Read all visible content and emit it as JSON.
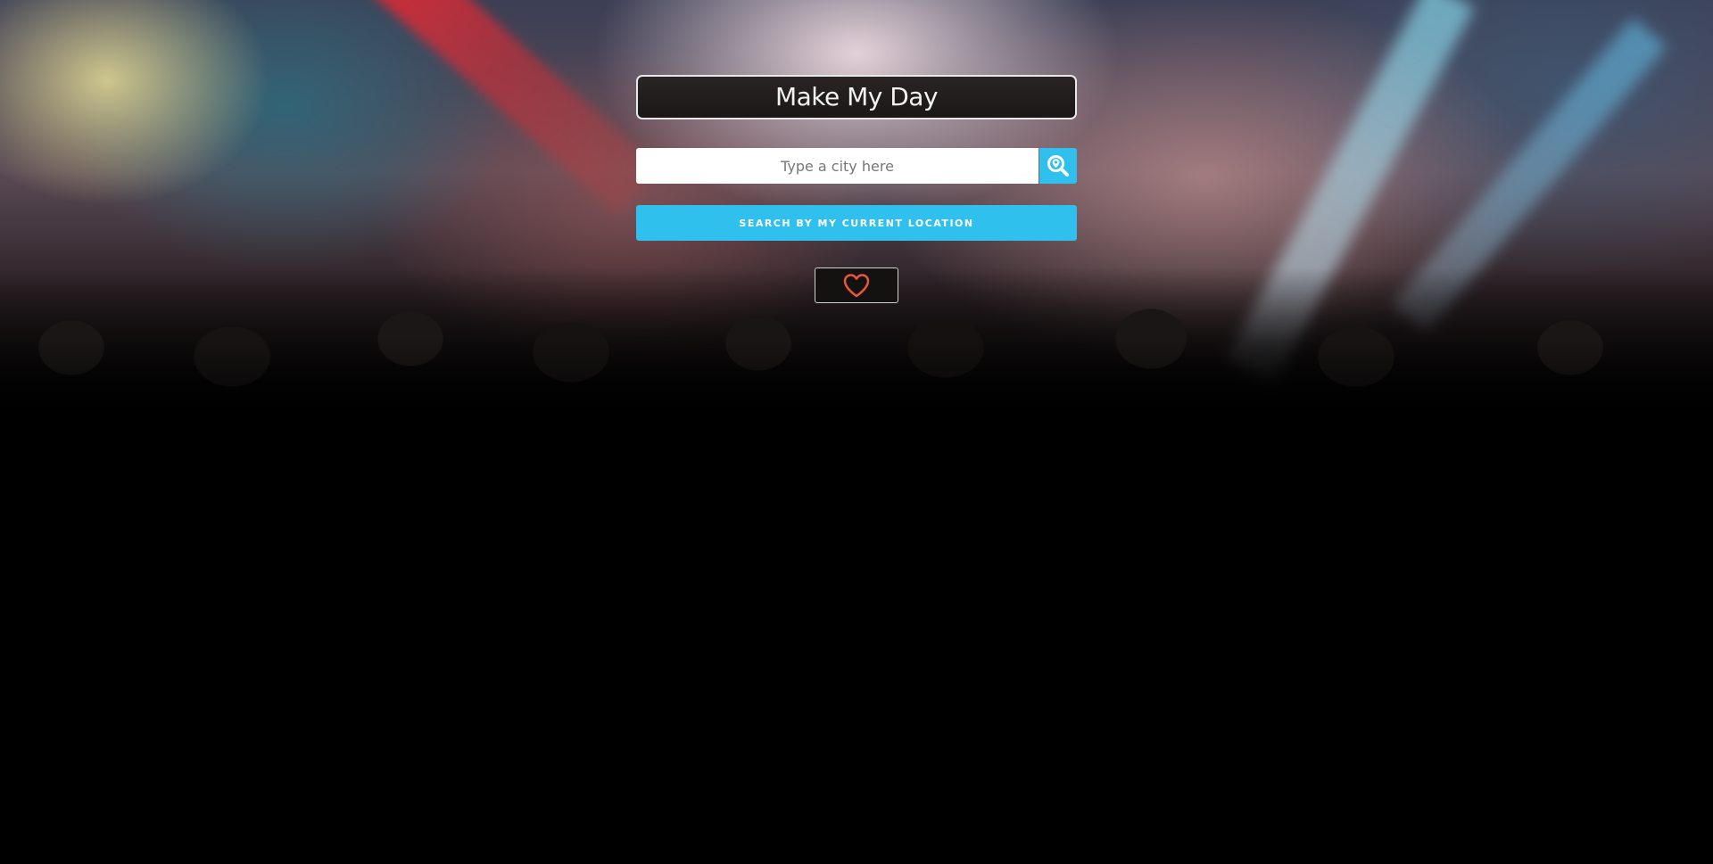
{
  "app": {
    "title": "Make My Day"
  },
  "search": {
    "placeholder": "Type a city here",
    "value": "",
    "button_icon": "map-pin-search-icon"
  },
  "location_button": {
    "label": "SEARCH BY MY CURRENT LOCATION"
  },
  "favorites_button": {
    "icon": "heart-icon"
  },
  "colors": {
    "accent": "#2fc0ee",
    "heart": "#e8553c",
    "title_bg": "#1e1a1a"
  }
}
